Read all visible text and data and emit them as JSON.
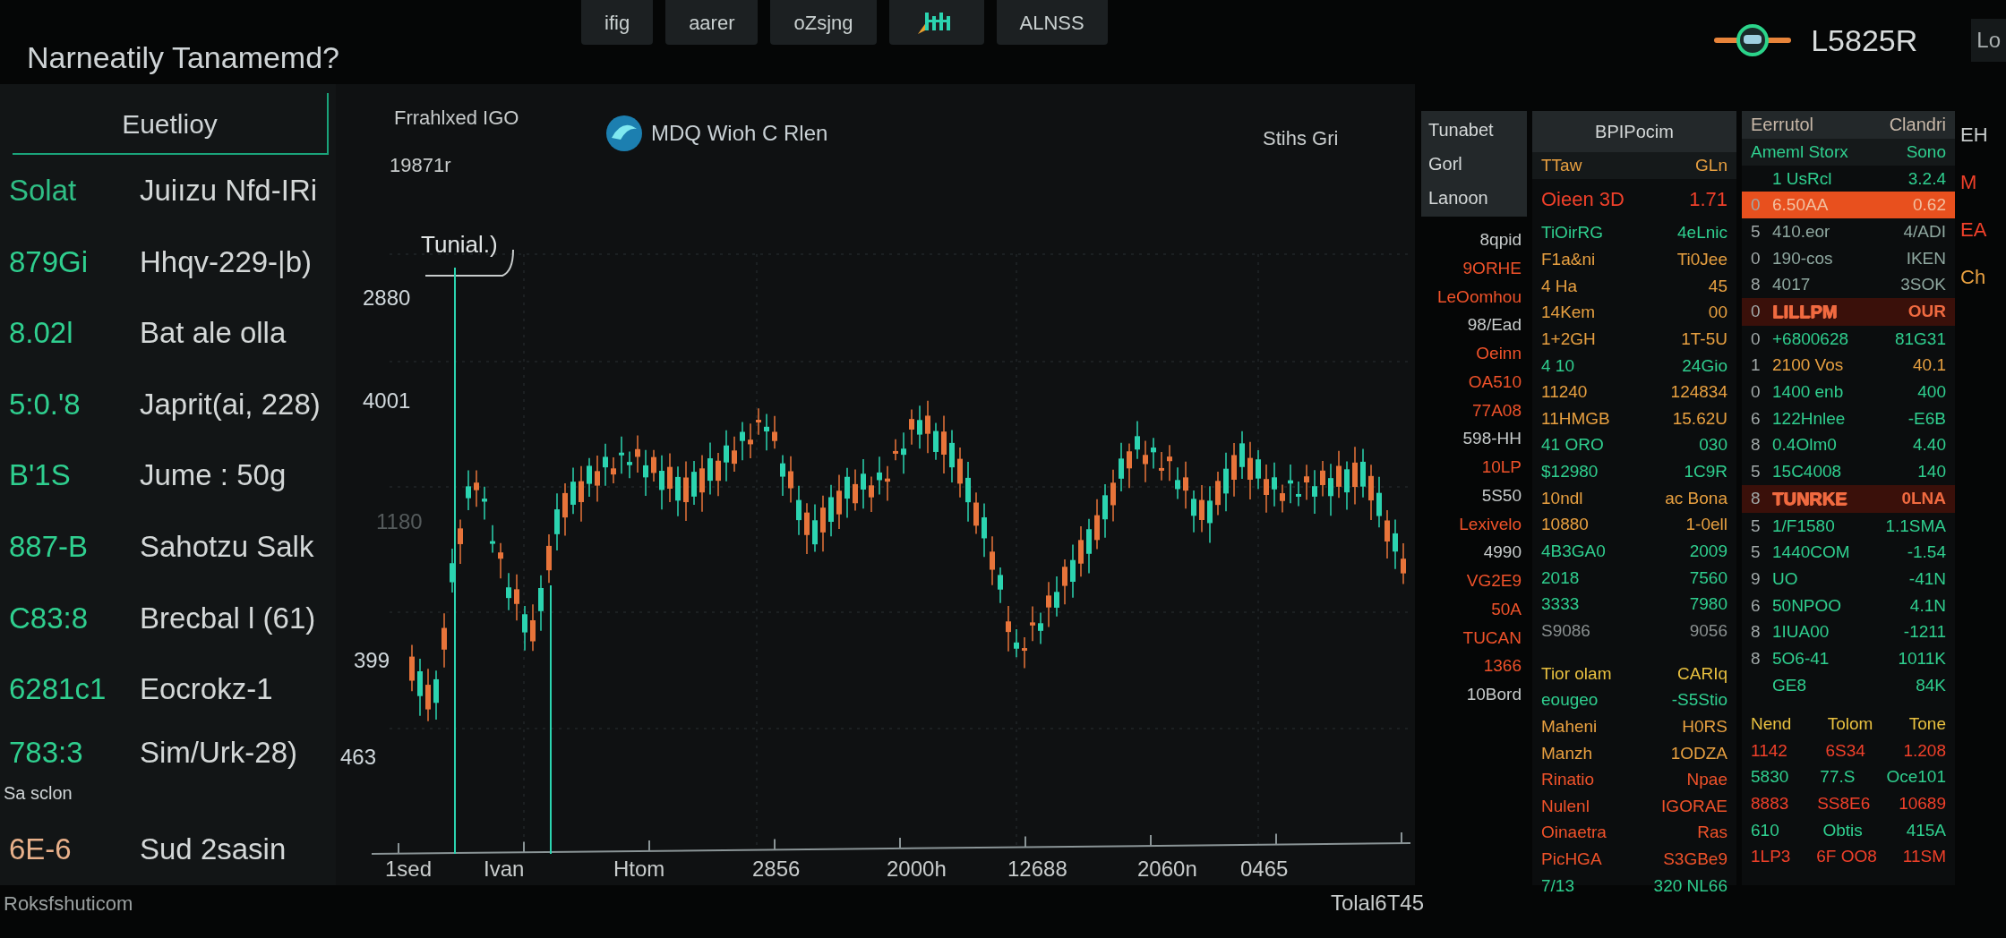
{
  "title": "Narneatily Tanamemd?",
  "top_tabs": [
    {
      "kind": "text",
      "label": "ifig"
    },
    {
      "kind": "text",
      "label": "aarer"
    },
    {
      "kind": "text",
      "label": "oZsjng"
    },
    {
      "kind": "icon"
    },
    {
      "kind": "text",
      "label": "ALNSS"
    }
  ],
  "ticker": {
    "value": "L5825R",
    "edge_label": "Lo"
  },
  "watchlist": {
    "title": "Euetlioy",
    "rows": [
      {
        "kind": "row",
        "value": "Solat",
        "label": "Juiızu  Nfd-IRi",
        "color": "#2fbf85"
      },
      {
        "kind": "row",
        "value": "879Gi",
        "label": "Hhqv-229-|b)",
        "color": "#2fcf8f"
      },
      {
        "kind": "row",
        "value": "8.02l",
        "label": "Bat ale olla",
        "color": "#2fcf8f"
      },
      {
        "kind": "row",
        "value": "5:0.'8",
        "label": "Japrit(ai, 228)",
        "color": "#2fcf8f"
      },
      {
        "kind": "row",
        "value": "B'1S",
        "label": "Jume : 50g",
        "color": "#2fcf8f"
      },
      {
        "kind": "row",
        "value": "887-B",
        "label": "Sahotzu Salk",
        "color": "#2fcf8f"
      },
      {
        "kind": "row",
        "value": "C83:8",
        "label": "Brecbal l (61)",
        "color": "#2fcf8f"
      },
      {
        "kind": "row",
        "value": "6281c1",
        "label": "Eocrokz-1",
        "color": "#2fcf8f"
      },
      {
        "kind": "row",
        "value": "783:3",
        "label": "Sim/Urk-28)",
        "color": "#2fcf8f",
        "note": "Sa sclon"
      },
      {
        "kind": "row",
        "value": "6E-6",
        "label": "Sud 2sasin",
        "color": "#e8b08a"
      }
    ]
  },
  "footer_left": "Roksfshuticom",
  "chart": {
    "title": "Frrahlxed IGO",
    "brand": "MDQ Wioh C Rlen",
    "corner_label": "Stihs Gri",
    "sub_label": "19871r",
    "annotation": "Tunial.)",
    "y_labels": [
      "2880",
      "4001",
      "1180",
      "399",
      "463"
    ],
    "x_labels": [
      "1sed",
      "Ivan",
      "Htom",
      "2856",
      "2000h",
      "12688",
      "2060n",
      "0465"
    ]
  },
  "chart_footer": "Tolal6T45",
  "board_labels": {
    "header": [
      "Tunabet",
      "Gorl",
      "Lanoon"
    ],
    "items": [
      {
        "label": "8qpid",
        "color": "#c8cccc"
      },
      {
        "label": "9ORHE",
        "color": "#f0522a"
      },
      {
        "label": "LeOomhou",
        "color": "#f0522a"
      },
      {
        "label": "98/Ead",
        "color": "#c8cccc"
      },
      {
        "label": "Oeinn",
        "color": "#f0522a"
      },
      {
        "label": "OA510",
        "color": "#f0522a"
      },
      {
        "label": "77A08",
        "color": "#f0522a"
      },
      {
        "label": "598-HH",
        "color": "#c8cccc"
      },
      {
        "label": "10LP",
        "color": "#f0522a"
      },
      {
        "label": "5S50",
        "color": "#c8cccc"
      },
      {
        "label": "Lexivelo",
        "color": "#f0522a"
      },
      {
        "label": "4990",
        "color": "#c8cccc"
      },
      {
        "label": "VG2E9",
        "color": "#f0522a"
      },
      {
        "label": "50A",
        "color": "#f0522a"
      },
      {
        "label": "TUCAN",
        "color": "#f0522a"
      },
      {
        "label": "1366",
        "color": "#f0522a"
      },
      {
        "label": "10Bord",
        "color": "#c8cccc"
      }
    ]
  },
  "board_prices": {
    "title": "BPIPocim",
    "subheader": [
      "TTaw",
      "GLn"
    ],
    "alert": [
      "Oieen 3D",
      "1.71"
    ],
    "rows": [
      {
        "cells": [
          "TiOirRG",
          "4eLnic"
        ],
        "color": "#2fcf8f"
      },
      {
        "cells": [
          "F1a&ni",
          "Ti0Jee"
        ],
        "color": "#e8a040"
      },
      {
        "cells": [
          "4 Ha",
          "45"
        ],
        "color": "#e8a040"
      },
      {
        "cells": [
          "14Kem",
          "00"
        ],
        "color": "#e8a040"
      },
      {
        "cells": [
          "1+2GH",
          "1T-5U"
        ],
        "color": "#e8a040"
      },
      {
        "cells": [
          "4 10",
          "24Gio"
        ],
        "color": "#2fcf8f"
      },
      {
        "cells": [
          "11240",
          "124834"
        ],
        "color": "#e8a040"
      },
      {
        "cells": [
          "11HMGB",
          "15.62U"
        ],
        "color": "#e8a040"
      },
      {
        "cells": [
          "41 ORO",
          "030"
        ],
        "color": "#2fcf8f"
      },
      {
        "cells": [
          "$12980",
          "1C9R"
        ],
        "color": "#2fcf8f"
      },
      {
        "cells": [
          "10ndl",
          "ac Bona"
        ],
        "color": "#e8a040"
      },
      {
        "cells": [
          "10880",
          "1-0ell"
        ],
        "color": "#e8a040"
      },
      {
        "cells": [
          "4B3GA0",
          "2009"
        ],
        "color": "#2fcf8f"
      },
      {
        "cells": [
          "2018",
          "7560"
        ],
        "color": "#2fcf8f"
      },
      {
        "cells": [
          "3333",
          "7980"
        ],
        "color": "#2fcf8f"
      },
      {
        "cells": [
          "S9086",
          "9056"
        ],
        "color": "#8a9090"
      }
    ],
    "section_title": [
      "Tior olam",
      "CARIq"
    ],
    "section_rows": [
      {
        "cells": [
          "eougeo",
          "-S5Stio"
        ],
        "color": "#2fcf8f"
      },
      {
        "cells": [
          "Maheni",
          "H0RS"
        ],
        "color": "#e8a040"
      },
      {
        "cells": [
          "Manzh",
          "1ODZA"
        ],
        "color": "#e8a040"
      },
      {
        "cells": [
          "Rinatio",
          "Npae"
        ],
        "color": "#f0522a"
      },
      {
        "cells": [
          "Nulenl",
          "IGORAE"
        ],
        "color": "#f0522a"
      },
      {
        "cells": [
          "Oinaetra",
          "Ras"
        ],
        "color": "#f0522a"
      },
      {
        "cells": [
          "PicHGA",
          "S3GBe9"
        ],
        "color": "#f0522a"
      },
      {
        "cells": [
          "7/13",
          "320 NL66"
        ],
        "color": "#2fcf8f"
      }
    ]
  },
  "board_orders": {
    "title": [
      "Eerrutol",
      "Clandri"
    ],
    "subheader": [
      "Ameml Storx",
      "Sono"
    ],
    "rows": [
      {
        "kind": "plain",
        "index": "",
        "name": "1 UsRcl",
        "value": "3.2.4",
        "color": "#2fcf8f"
      },
      {
        "kind": "alert",
        "index": "0",
        "name": "6.50AA",
        "value": "0.62",
        "color": "#f2c0a0"
      },
      {
        "kind": "plain",
        "index": "5",
        "name": "410.eor",
        "value": "4/ADI",
        "color": "#8fa8a0"
      },
      {
        "kind": "plain",
        "index": "0",
        "name": "190-cos",
        "value": "IKEN",
        "color": "#8fa8a0"
      },
      {
        "kind": "plain",
        "index": "8",
        "name": "4017",
        "value": "3SOK",
        "color": "#8fa8a0"
      },
      {
        "kind": "faint-alert",
        "index": "0",
        "name": "LILLPM",
        "value": "OUR",
        "color": "#f06a40"
      },
      {
        "kind": "plain",
        "index": "0",
        "name": "+6800628",
        "value": "81G31",
        "color": "#2fcf8f"
      },
      {
        "kind": "plain",
        "index": "1",
        "name": "2100 Vos",
        "value": "40.1",
        "color": "#e8a040"
      },
      {
        "kind": "plain",
        "index": "0",
        "name": "1400 enb",
        "value": "400",
        "color": "#2fcf8f"
      },
      {
        "kind": "plain",
        "index": "6",
        "name": "122Hnlee",
        "value": "-E6B",
        "color": "#2fcf8f"
      },
      {
        "kind": "plain",
        "index": "8",
        "name": "0.4Olm0",
        "value": "4.40",
        "color": "#2fcf8f"
      },
      {
        "kind": "plain",
        "index": "5",
        "name": "15C4008",
        "value": "140",
        "color": "#2fcf8f"
      },
      {
        "kind": "faint-alert",
        "index": "8",
        "name": "TUNRKE",
        "value": "0LNA",
        "color": "#f06a40"
      },
      {
        "kind": "plain",
        "index": "5",
        "name": "1/F1580",
        "value": "1.1SMA",
        "color": "#2fcf8f"
      },
      {
        "kind": "plain",
        "index": "5",
        "name": "1440COM",
        "value": "-1.54",
        "color": "#2fcf8f"
      },
      {
        "kind": "plain",
        "index": "9",
        "name": "UO",
        "value": "-41N",
        "color": "#2fcf8f"
      },
      {
        "kind": "plain",
        "index": "6",
        "name": "50NPOO",
        "value": "4.1N",
        "color": "#2fcf8f"
      },
      {
        "kind": "plain",
        "index": "8",
        "name": "1IUA00",
        "value": "-1211",
        "color": "#2fcf8f"
      },
      {
        "kind": "plain",
        "index": "8",
        "name": "5O6-41",
        "value": "1011K",
        "color": "#2fcf8f"
      },
      {
        "kind": "plain",
        "index": "",
        "name": "GE8",
        "value": "84K",
        "color": "#2fcf8f"
      }
    ],
    "section_title": [
      "Nend",
      "Tolom",
      "Tone"
    ],
    "section_rows": [
      {
        "cells": [
          "1142",
          "6S34",
          "1.208"
        ],
        "color": "#f0402a"
      },
      {
        "cells": [
          "5830",
          "77.S",
          "Oce101"
        ],
        "color": "#2fcf8f"
      },
      {
        "cells": [
          "8883",
          "SS8E6",
          "10689"
        ],
        "color": "#f0402a"
      },
      {
        "cells": [
          "610",
          "Obtis",
          "415A"
        ],
        "color": "#2fcf8f"
      },
      {
        "cells": [
          "1LP3",
          "6F OO8",
          "11SM"
        ],
        "color": "#f0402a"
      }
    ]
  },
  "board_edge": [
    {
      "label": "EH",
      "color": "#c8cccc"
    },
    {
      "label": "M",
      "color": "#f0402a"
    },
    {
      "label": "EA",
      "color": "#f0402a"
    },
    {
      "label": "Ch",
      "color": "#e8a040"
    }
  ]
}
